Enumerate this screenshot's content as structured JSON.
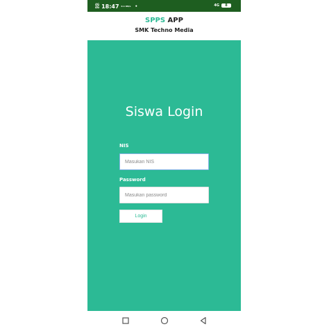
{
  "status_bar": {
    "signal_1": "4G",
    "signal_2": "4G",
    "time": "18:47",
    "net_speed": "0.1 KB/s",
    "dot": "•",
    "network": "4G",
    "battery": "8"
  },
  "header": {
    "title_accent": "SPPS",
    "title_rest": " APP",
    "subtitle": "SMK Techno Media"
  },
  "login": {
    "title": "Siswa Login",
    "nis_label": "NIS",
    "nis_placeholder": "Masukan NIS",
    "password_label": "Password",
    "password_placeholder": "Masukan password",
    "button_label": "Login"
  },
  "nav": {
    "icons": [
      "recent-apps-icon",
      "home-icon",
      "back-icon"
    ]
  },
  "colors": {
    "accent": "#2cba95",
    "status_bar": "#1e5e20"
  }
}
